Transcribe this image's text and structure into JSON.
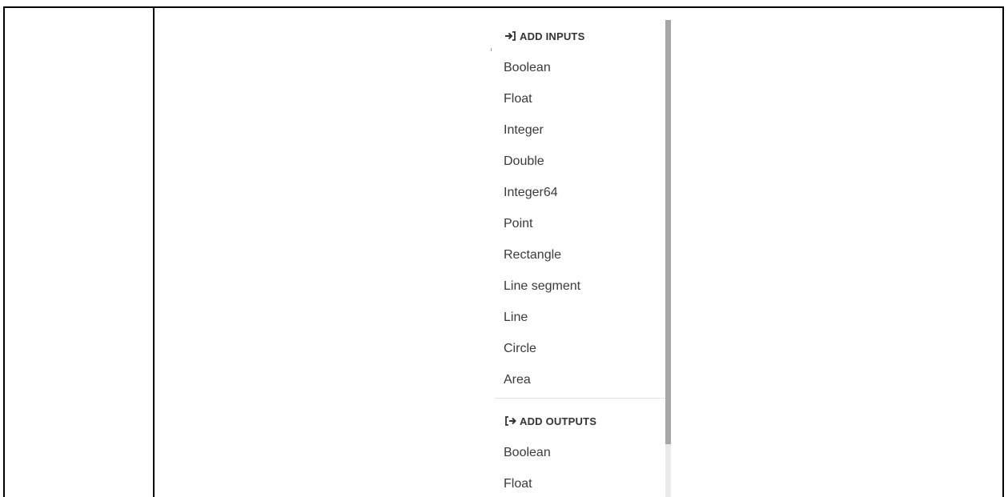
{
  "menu": {
    "inputs_header": "ADD INPUTS",
    "inputs_icon": "sign-in-icon",
    "inputs": [
      "Boolean",
      "Float",
      "Integer",
      "Double",
      "Integer64",
      "Point",
      "Rectangle",
      "Line segment",
      "Line",
      "Circle",
      "Area"
    ],
    "outputs_header": "ADD OUTPUTS",
    "outputs_icon": "sign-out-icon",
    "outputs": [
      "Boolean",
      "Float"
    ],
    "scroll_position": 0.0,
    "scroll_visible_fraction": 0.89
  },
  "colors": {
    "text": "#333333",
    "divider": "#e2e2e2",
    "scrollbar_thumb": "#a6a6a6",
    "scrollbar_track": "#eaeaea",
    "border": "#000000"
  }
}
